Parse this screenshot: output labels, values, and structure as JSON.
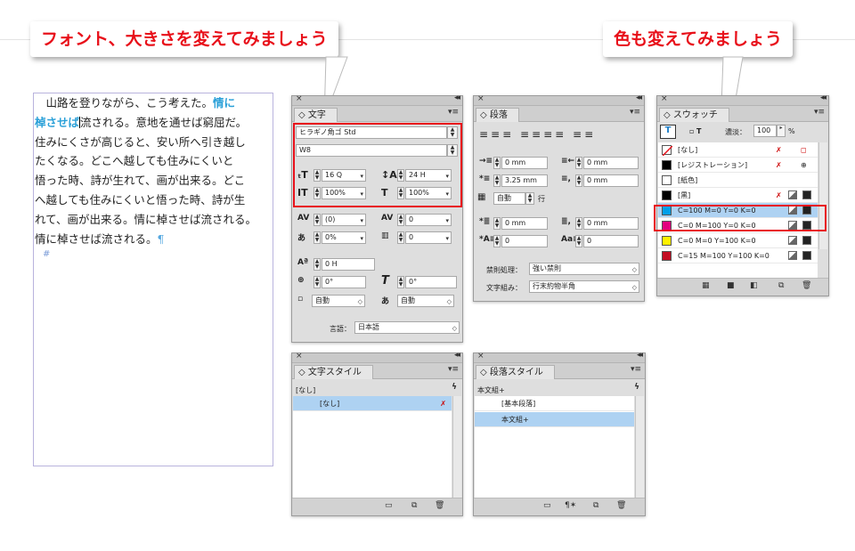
{
  "callouts": {
    "font": "フォント、大きさを変えてみましょう",
    "color": "色も変えてみましょう"
  },
  "doc": {
    "lines": [
      {
        "pre": "　山路を登りながら、こう考えた。",
        "hl": "情に"
      },
      {
        "hl": "棹させば",
        "post": "流される。意地を通せば窮屈だ。"
      },
      {
        "pre": "住みにくさが高じると、安い所へ引き越し"
      },
      {
        "pre": "たくなる。どこへ越しても住みにくいと"
      },
      {
        "pre": "悟った時、詩が生れて、画が出来る。どこ"
      },
      {
        "pre": "へ越しても住みにくいと悟った時、詩が生"
      },
      {
        "pre": "れて、画が出来る。情に棹させば流される。"
      },
      {
        "pre": "情に棹させば流される。",
        "pil": "¶"
      }
    ],
    "end_mark": "#"
  },
  "char_panel": {
    "tab": "文字",
    "font_family": "ヒラギノ角ゴ Std",
    "font_style": "W8",
    "size": "16 Q",
    "leading": "24 H",
    "vscale": "100%",
    "hscale": "100%",
    "kerning": "(0)",
    "tracking": "0",
    "tsume": "0%",
    "aki": "0",
    "baseline": "0 H",
    "rotate": "0°",
    "skew": "0°",
    "aki_before": "自動",
    "aki_after": "自動",
    "lang_label": "言語：",
    "lang": "日本語"
  },
  "para_panel": {
    "tab": "段落",
    "left_indent": "0 mm",
    "right_indent": "0 mm",
    "first_indent": "3.25 mm",
    "last_indent": "0 mm",
    "dropcap_lines": "自動",
    "dropcap_unit": "行",
    "space_before": "0 mm",
    "space_after": "0 mm",
    "dropcap_chars": "0",
    "dropcap_n": "0",
    "kinsoku_label": "禁則処理：",
    "kinsoku": "強い禁則",
    "mojikumi_label": "文字組み：",
    "mojikumi": "行末約物半角"
  },
  "swatch_panel": {
    "tab": "スウォッチ",
    "tint_label": "濃淡：",
    "tint": "100",
    "tint_unit": "%",
    "items": [
      {
        "name": "[なし]",
        "color": "none"
      },
      {
        "name": "[レジストレーション]",
        "color": "#000000"
      },
      {
        "name": "[紙色]",
        "color": "#ffffff"
      },
      {
        "name": "[黒]",
        "color": "#000000"
      },
      {
        "name": "C=100 M=0 Y=0 K=0",
        "color": "#00a0e9",
        "selected": true
      },
      {
        "name": "C=0 M=100 Y=0 K=0",
        "color": "#e4007f"
      },
      {
        "name": "C=0 M=0 Y=100 K=0",
        "color": "#fff100"
      },
      {
        "name": "C=15 M=100 Y=100 K=0",
        "color": "#c30d23"
      }
    ]
  },
  "char_style_panel": {
    "tab": "文字スタイル",
    "current": "[なし]",
    "items": [
      "[なし]"
    ]
  },
  "para_style_panel": {
    "tab": "段落スタイル",
    "current": "本文組+",
    "items": [
      "[基本段落]",
      "本文組+"
    ]
  }
}
